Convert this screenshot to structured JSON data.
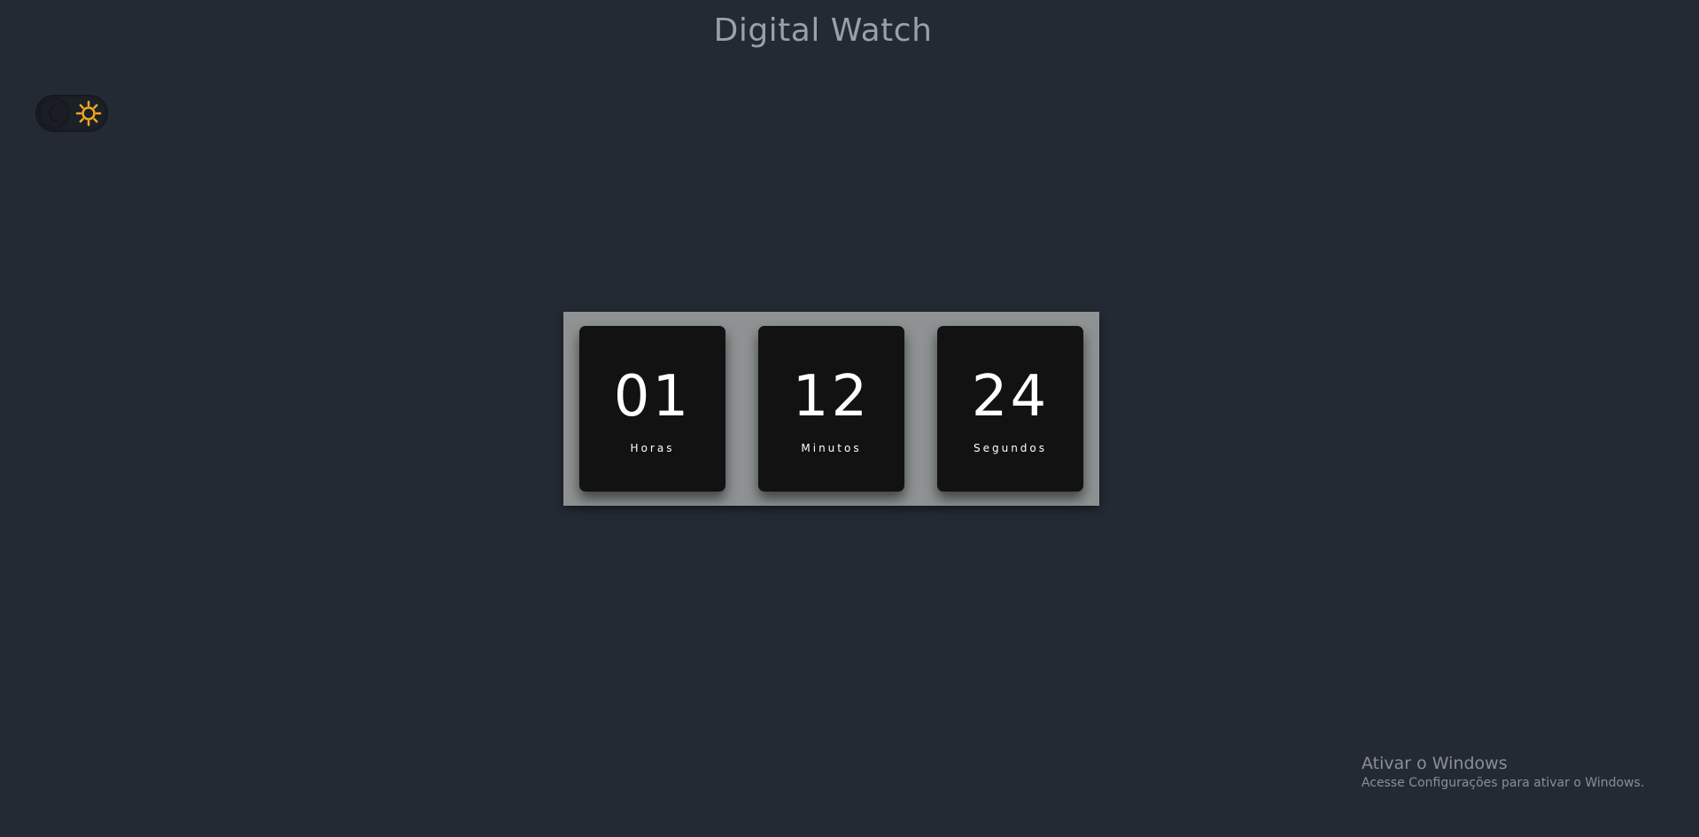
{
  "page": {
    "title": "Digital Watch"
  },
  "theme_toggle": {
    "left_icon": "moon-icon",
    "right_icon": "sun-icon",
    "sun_color": "#f5a623"
  },
  "clock": {
    "hours": {
      "value": "01",
      "label": "Horas"
    },
    "minutes": {
      "value": "12",
      "label": "Minutos"
    },
    "seconds": {
      "value": "24",
      "label": "Segundos"
    }
  },
  "os_watermark": {
    "title": "Ativar o Windows",
    "subtitle": "Acesse Configurações para ativar o Windows."
  },
  "colors": {
    "background": "#242a34",
    "panel": "#8e9293",
    "card": "#121212",
    "text": "#ffffff"
  }
}
